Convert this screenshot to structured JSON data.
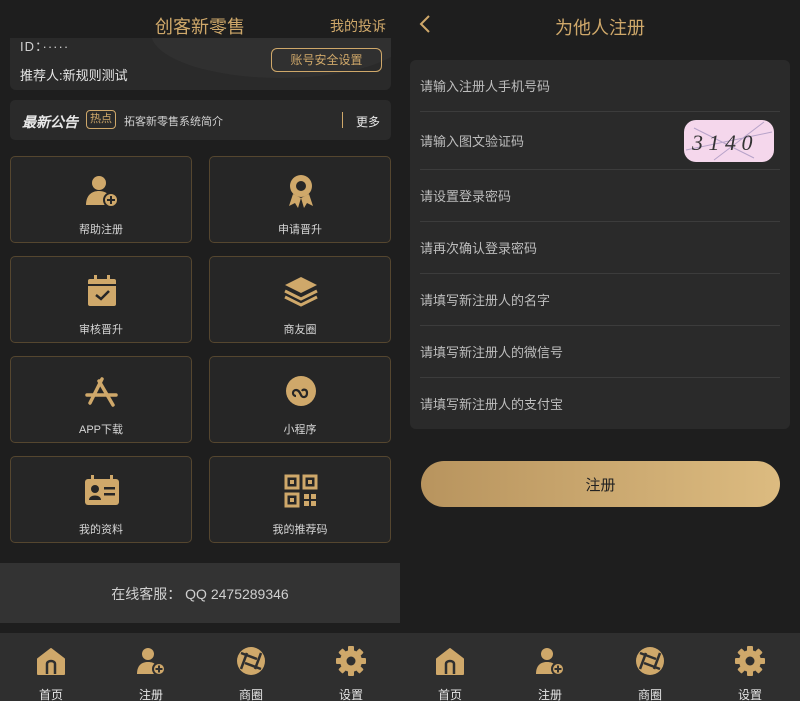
{
  "left": {
    "header": {
      "title": "创客新零售",
      "complain": "我的投诉"
    },
    "profile": {
      "top_text": "ID：····· ",
      "referrer": "推荐人:新规则测试",
      "security_button": "账号安全设置"
    },
    "notice": {
      "title": "最新公告",
      "hot_badge": "热点",
      "text": "拓客新零售系统简介",
      "more": "更多"
    },
    "grid": [
      {
        "label": "帮助注册",
        "icon": "add-user-icon"
      },
      {
        "label": "申请晋升",
        "icon": "award-icon"
      },
      {
        "label": "审核晋升",
        "icon": "calendar-check-icon"
      },
      {
        "label": "商友圈",
        "icon": "layers-icon"
      },
      {
        "label": "APP下载",
        "icon": "app-store-icon"
      },
      {
        "label": "小程序",
        "icon": "mini-program-icon"
      },
      {
        "label": "我的资料",
        "icon": "profile-card-icon"
      },
      {
        "label": "我的推荐码",
        "icon": "qr-code-icon"
      }
    ],
    "service": {
      "label": "在线客服：",
      "qq": "QQ 2475289346"
    }
  },
  "tabbar": [
    {
      "label": "首页",
      "icon": "home-icon"
    },
    {
      "label": "注册",
      "icon": "add-user-icon"
    },
    {
      "label": "商圈",
      "icon": "aperture-icon"
    },
    {
      "label": "设置",
      "icon": "gear-icon"
    }
  ],
  "right": {
    "header": {
      "title": "为他人注册"
    },
    "fields": [
      {
        "placeholder": "请输入注册人手机号码"
      },
      {
        "placeholder": "请输入图文验证码"
      },
      {
        "placeholder": "请设置登录密码"
      },
      {
        "placeholder": "请再次确认登录密码"
      },
      {
        "placeholder": "请填写新注册人的名字"
      },
      {
        "placeholder": "请填写新注册人的微信号"
      },
      {
        "placeholder": "请填写新注册人的支付宝"
      }
    ],
    "captcha_text": "3 1 4 0",
    "register_button": "注册"
  },
  "colors": {
    "accent": "#cfa86a",
    "background": "#1e1e1e",
    "card": "#2a2a2a"
  }
}
